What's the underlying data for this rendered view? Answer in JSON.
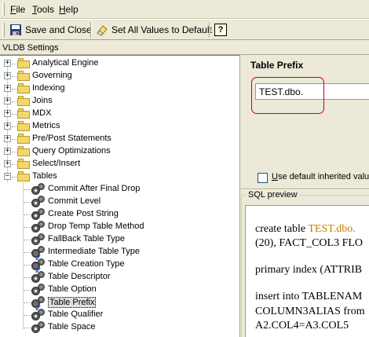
{
  "menu": {
    "file": "File",
    "tools": "Tools",
    "help": "Help"
  },
  "toolbar": {
    "save_close": "Save and Close",
    "set_defaults": "Set All Values to Default",
    "help_icon": "?"
  },
  "header": {
    "title": "VLDB Settings"
  },
  "tree": {
    "categories": [
      {
        "label": "Analytical Engine"
      },
      {
        "label": "Governing"
      },
      {
        "label": "Indexing"
      },
      {
        "label": "Joins"
      },
      {
        "label": "MDX"
      },
      {
        "label": "Metrics"
      },
      {
        "label": "Pre/Post Statements"
      },
      {
        "label": "Query Optimizations"
      },
      {
        "label": "Select/Insert"
      },
      {
        "label": "Tables"
      }
    ],
    "tables_children": [
      {
        "label": "Commit After Final Drop",
        "modified": false
      },
      {
        "label": "Commit Level",
        "modified": false
      },
      {
        "label": "Create Post String",
        "modified": false
      },
      {
        "label": "Drop Temp Table Method",
        "modified": false
      },
      {
        "label": "FallBack Table Type",
        "modified": false
      },
      {
        "label": "Intermediate Table Type",
        "modified": true
      },
      {
        "label": "Table Creation Type",
        "modified": true
      },
      {
        "label": "Table Descriptor",
        "modified": false
      },
      {
        "label": "Table Option",
        "modified": false
      },
      {
        "label": "Table Prefix",
        "modified": true,
        "selected": true
      },
      {
        "label": "Table Qualifier",
        "modified": false
      },
      {
        "label": "Table Space",
        "modified": false
      }
    ],
    "expand_plus": "+",
    "expand_minus": "−"
  },
  "detail": {
    "title": "Table Prefix",
    "prefix_value": "TEST.dbo.",
    "inherit_label": "Use default inherited value",
    "sql_preview_label": "SQL preview",
    "highlight_color": "#c08000",
    "sql_lines": {
      "l1_pre": "create table ",
      "l1_hl": "TEST.dbo.",
      "l2": "(20), FACT_COL3 FLO",
      "l3": "primary index (ATTRIB",
      "l4": "insert into TABLENAM",
      "l5": "COLUMN3ALIAS from",
      "l6": "A2.COL4=A3.COL5"
    }
  }
}
